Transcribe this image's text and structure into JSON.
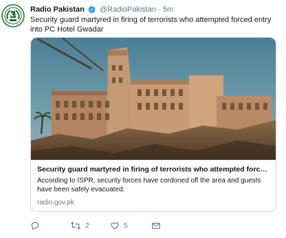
{
  "author": {
    "name": "Radio Pakistan",
    "handle": "@RadioPakistan",
    "separator": "·",
    "time": "5m",
    "avatar_icon": "radio-pakistan-logo",
    "verified_icon": "verified-badge-icon"
  },
  "tweet_text": "Security guard martyred in firing of terrorists who attempted forced entry into PC Hotel Gwadar",
  "card": {
    "image_icon": "hotel-photo",
    "title": "Security guard martyred in firing of terrorists who attempted forced e...",
    "description": "According to ISPR, security forces have cordoned off the area and guests have been safely evacuated.",
    "domain": "radio.gov.pk"
  },
  "actions": {
    "reply_count": "",
    "retweet_count": "2",
    "like_count": "5"
  },
  "colors": {
    "verified": "#1da1f2",
    "muted": "#657786",
    "border": "#ccd6dd"
  }
}
